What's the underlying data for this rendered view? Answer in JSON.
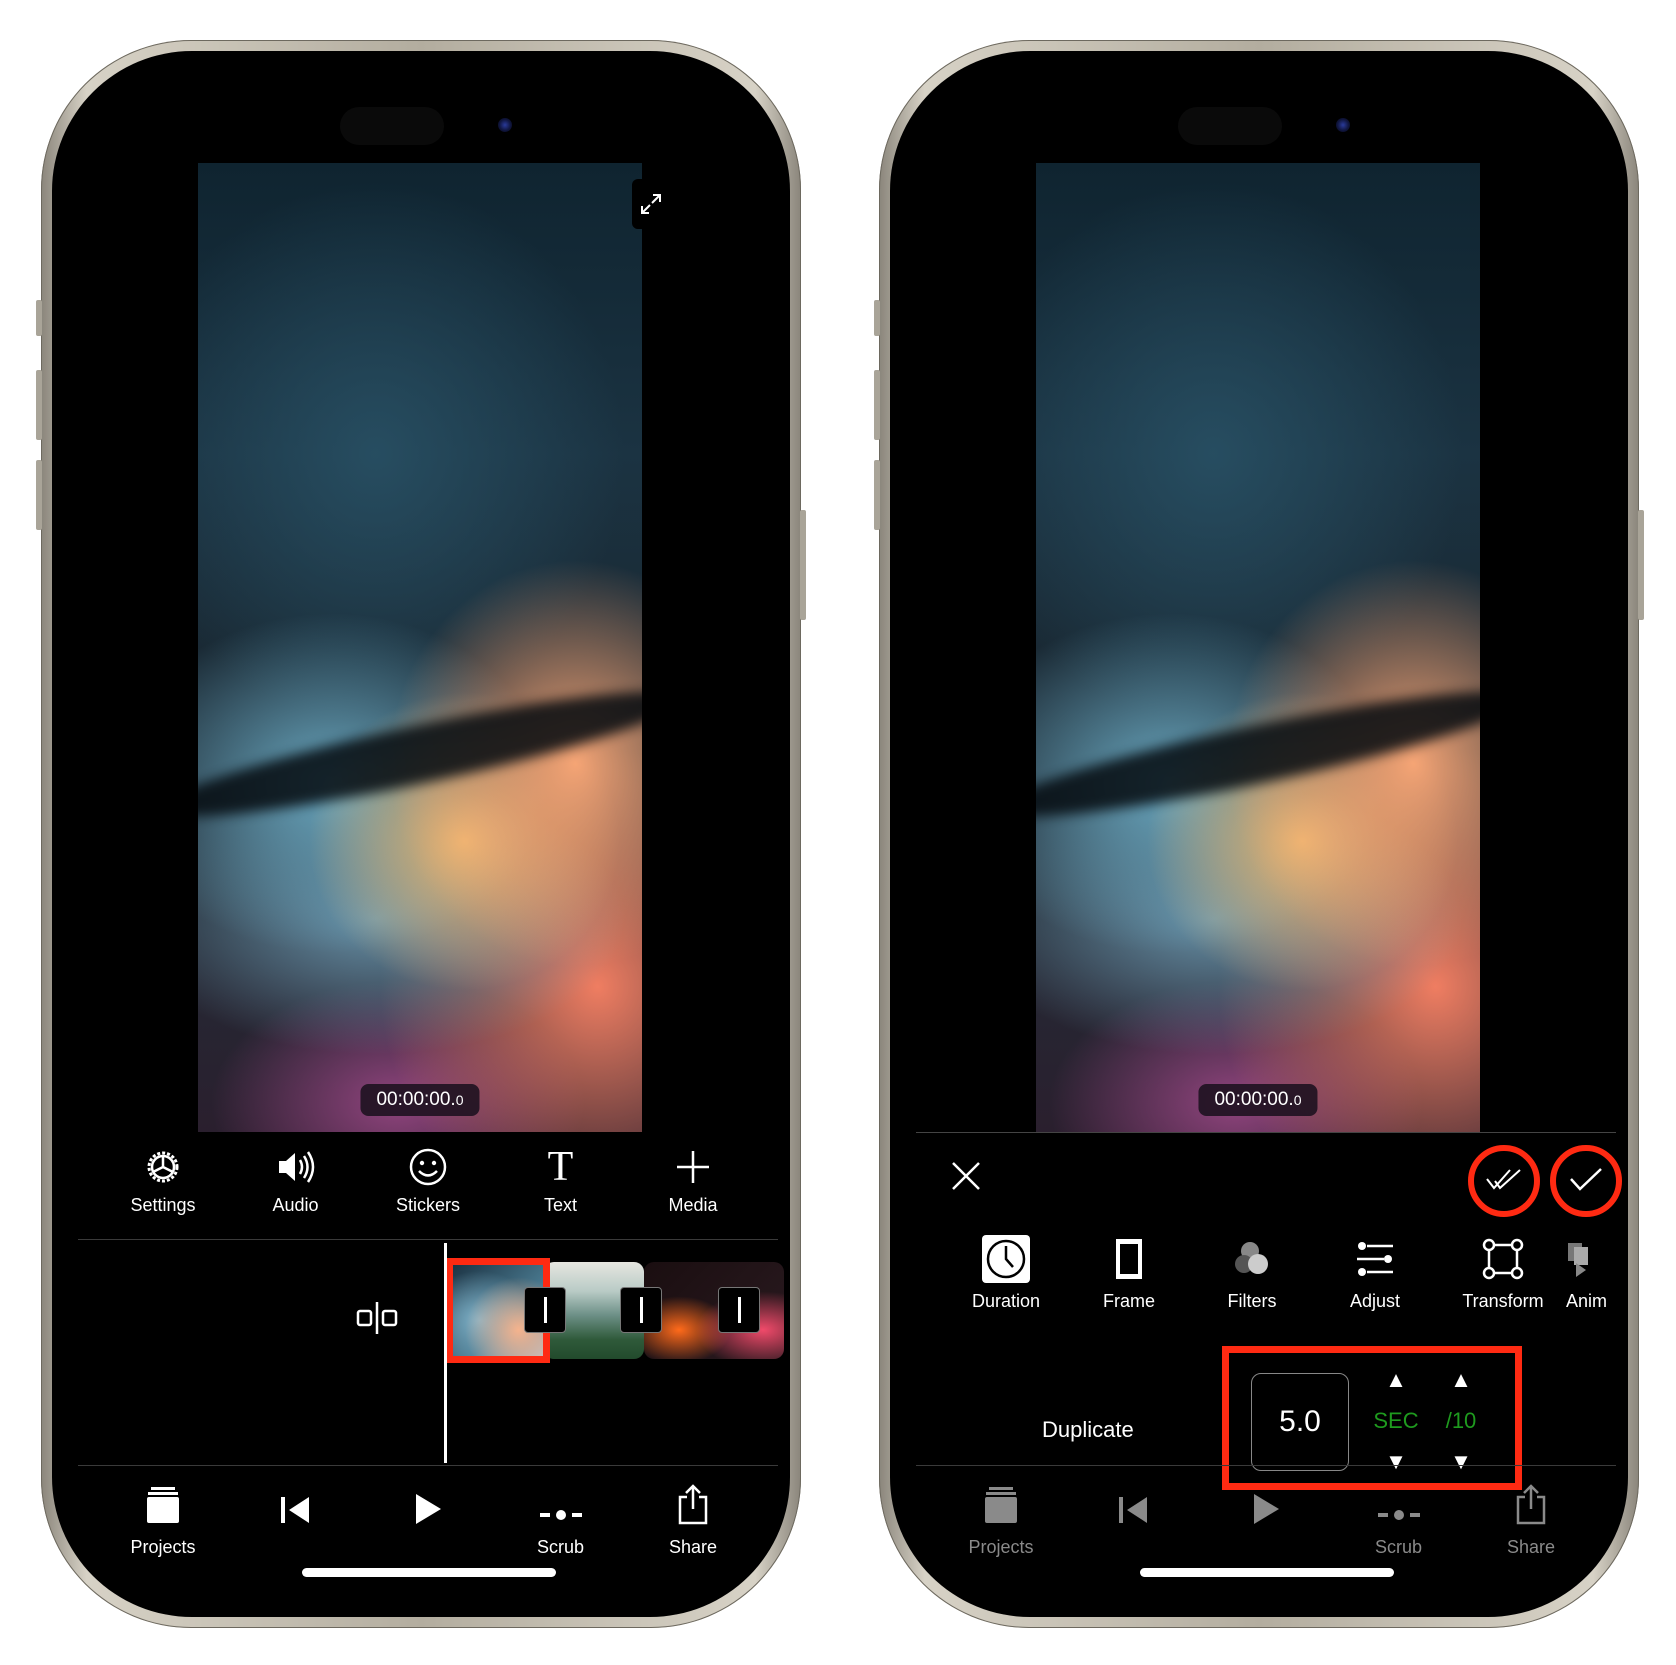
{
  "left_phone": {
    "video": {
      "timecode_main": "00:00:00.",
      "timecode_frac": "0",
      "expand_icon": "expand-arrows-icon"
    },
    "toolbar": [
      {
        "label": "Settings",
        "icon": "gear-icon",
        "glyph": "⚙"
      },
      {
        "label": "Audio",
        "icon": "speaker-icon",
        "glyph": "🔊"
      },
      {
        "label": "Stickers",
        "icon": "smiley-icon",
        "glyph": "☺"
      },
      {
        "label": "Text",
        "icon": "text-t-icon",
        "glyph": "T"
      },
      {
        "label": "Media",
        "icon": "plus-icon",
        "glyph": "+"
      }
    ],
    "timeline": {
      "split_icon": "split-icon",
      "clips": [
        "Abstract wave clip",
        "Landscape clip",
        "Abstract colorful clip"
      ],
      "selected_clip_index": 0
    },
    "bottom_nav": [
      {
        "label": "Projects",
        "icon": "projects-stack-icon"
      },
      {
        "label": "",
        "icon": "skip-back-icon"
      },
      {
        "label": "",
        "icon": "play-icon"
      },
      {
        "label": "Scrub",
        "icon": "scrub-icon"
      },
      {
        "label": "Share",
        "icon": "share-icon"
      }
    ]
  },
  "right_phone": {
    "video": {
      "timecode_main": "00:00:00.",
      "timecode_frac": "0"
    },
    "edit_bar": {
      "close_glyph": "✕",
      "apply_all_glyph": "✓✓",
      "apply_glyph": "✓"
    },
    "edit_tools": [
      {
        "label": "Duration",
        "icon": "clock-icon"
      },
      {
        "label": "Frame",
        "icon": "frame-icon"
      },
      {
        "label": "Filters",
        "icon": "filters-icon"
      },
      {
        "label": "Adjust",
        "icon": "sliders-icon"
      },
      {
        "label": "Transform",
        "icon": "transform-icon"
      },
      {
        "label": "Anim",
        "icon": "animation-icon"
      }
    ],
    "duration_panel": {
      "action_label": "Duplicate",
      "value": "5.0",
      "unit_sec": "SEC",
      "unit_tenth": "/10",
      "up_glyph": "▲",
      "down_glyph": "▼"
    },
    "bottom_nav": [
      {
        "label": "Projects",
        "icon": "projects-stack-icon"
      },
      {
        "label": "",
        "icon": "skip-back-icon"
      },
      {
        "label": "",
        "icon": "play-icon"
      },
      {
        "label": "Scrub",
        "icon": "scrub-icon"
      },
      {
        "label": "Share",
        "icon": "share-icon"
      }
    ]
  },
  "colors": {
    "highlight": "#ff2a12",
    "unit_green": "#1e9a1e",
    "dim_gray": "#8a8a8a"
  }
}
